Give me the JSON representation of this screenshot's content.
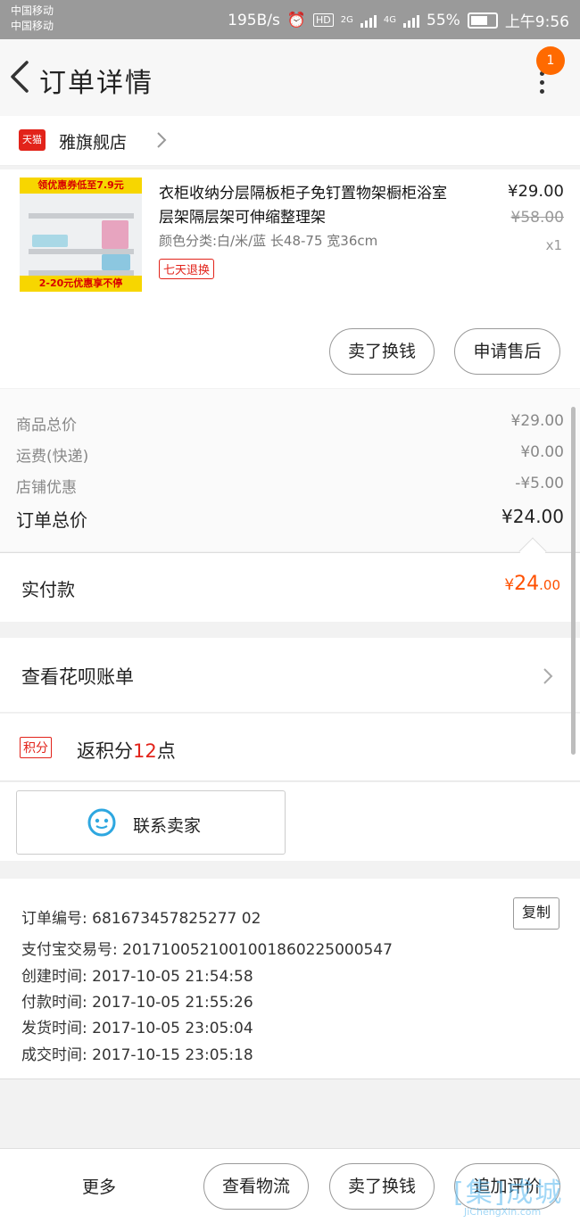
{
  "status_bar": {
    "carrier1": "中国移动",
    "carrier2": "中国移动",
    "speed": "195B/s",
    "network": "2G",
    "network2": "4G",
    "battery": "55%",
    "time": "上午9:56"
  },
  "header": {
    "title": "订单详情",
    "badge": "1"
  },
  "shop": {
    "tag": "天猫",
    "name": "雅旗舰店"
  },
  "product": {
    "img_top": "领优惠券低至7.9元",
    "img_bottom": "2-20元优惠享不停",
    "title": "衣柜收纳分层隔板柜子免钉置物架橱柜浴室层架隔层架可伸缩整理架",
    "spec": "颜色分类:白/米/蓝 长48-75 宽36cm",
    "return_tag": "七天退换",
    "price": "¥29.00",
    "original_price": "¥58.00",
    "quantity": "x1",
    "btn_exchange": "卖了换钱",
    "btn_aftersale": "申请售后"
  },
  "summary": {
    "rows": [
      {
        "label": "商品总价",
        "value": "¥29.00"
      },
      {
        "label": "运费(快递)",
        "value": "¥0.00"
      },
      {
        "label": "店铺优惠",
        "value": "-¥5.00"
      }
    ],
    "total_label": "订单总价",
    "total_value": "¥24.00"
  },
  "paid": {
    "label": "实付款",
    "symbol": "¥",
    "int": "24",
    "dec": ".00"
  },
  "huabei": {
    "label": "查看花呗账单"
  },
  "points": {
    "tag": "积分",
    "prefix": "返积分",
    "number": "12",
    "suffix": "点"
  },
  "contact": {
    "label": "联系卖家"
  },
  "order_info": {
    "order_no": "订单编号: 681673457825277 02",
    "alipay_no": "支付宝交易号: 2017100521001001860225000547",
    "created": "创建时间: 2017-10-05 21:54:58",
    "paid": "付款时间: 2017-10-05 21:55:26",
    "shipped": "发货时间: 2017-10-05 23:05:04",
    "completed": "成交时间: 2017-10-15 23:05:18",
    "copy": "复制"
  },
  "bottom_bar": {
    "more": "更多",
    "logistics": "查看物流",
    "sell": "卖了换钱",
    "review": "追加评价"
  },
  "watermark": {
    "mark": "[集]成城",
    "url": "JiChengXin.com"
  },
  "colors": {
    "accent_orange": "#ff5000",
    "tmall_red": "#e2231a",
    "badge_orange": "#ff6a00"
  }
}
